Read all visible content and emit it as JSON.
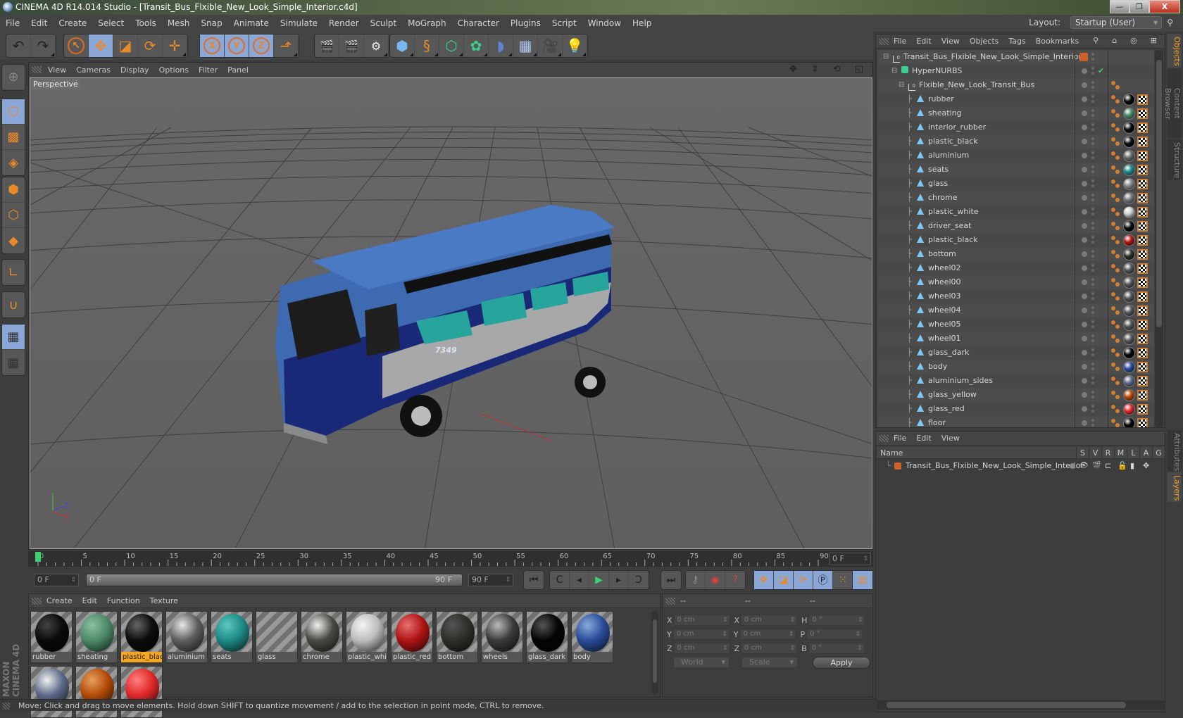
{
  "window": {
    "title": "CINEMA 4D R14.014 Studio - [Transit_Bus_Flxible_New_Look_Simple_Interior.c4d]",
    "minimize": "—",
    "restore": "❐",
    "close": "X"
  },
  "menubar": {
    "items": [
      "File",
      "Edit",
      "Create",
      "Select",
      "Tools",
      "Mesh",
      "Snap",
      "Animate",
      "Simulate",
      "Render",
      "Sculpt",
      "MoGraph",
      "Character",
      "Plugins",
      "Script",
      "Window",
      "Help"
    ],
    "layout_label": "Layout:",
    "layout_value": "Startup (User)"
  },
  "toolbar": {
    "groups": [
      [
        {
          "icon": "undo-icon",
          "glyph": "↶"
        },
        {
          "icon": "redo-icon",
          "glyph": "↷"
        }
      ],
      [
        {
          "icon": "live-selection-icon",
          "glyph": "↖"
        },
        {
          "icon": "move-icon",
          "glyph": "✥",
          "active": true
        },
        {
          "icon": "scale-icon",
          "glyph": "◪"
        },
        {
          "icon": "rotate-icon",
          "glyph": "⟳"
        },
        {
          "icon": "recent-tool-icon",
          "glyph": "✛"
        }
      ],
      [
        {
          "icon": "x-axis-lock-icon",
          "glyph": "X",
          "active": true
        },
        {
          "icon": "y-axis-lock-icon",
          "glyph": "Y",
          "active": true
        },
        {
          "icon": "z-axis-lock-icon",
          "glyph": "Z",
          "active": true
        },
        {
          "icon": "coordinate-system-icon",
          "glyph": "⬏"
        }
      ],
      [
        {
          "icon": "render-view-icon",
          "glyph": "🎬"
        },
        {
          "icon": "render-picture-viewer-icon",
          "glyph": "🎬"
        },
        {
          "icon": "render-settings-icon",
          "glyph": "⚙"
        }
      ],
      [
        {
          "icon": "cube-icon",
          "glyph": "⬢"
        },
        {
          "icon": "spline-icon",
          "glyph": "§"
        },
        {
          "icon": "nurbs-icon",
          "glyph": "⬡"
        },
        {
          "icon": "array-icon",
          "glyph": "✿"
        },
        {
          "icon": "deformer-icon",
          "glyph": "◗"
        },
        {
          "icon": "floor-icon",
          "glyph": "▦"
        },
        {
          "icon": "camera-icon",
          "glyph": "🎥"
        },
        {
          "icon": "light-icon",
          "glyph": "💡"
        }
      ]
    ]
  },
  "viewport": {
    "menu": [
      "View",
      "Cameras",
      "Display",
      "Options",
      "Filter",
      "Panel"
    ],
    "label": "Perspective",
    "bus_number": "7349",
    "axis_labels": {
      "x": "X",
      "y": "Y",
      "z": "Z"
    }
  },
  "timeline": {
    "ticks": [
      "0",
      "5",
      "10",
      "15",
      "20",
      "25",
      "30",
      "35",
      "40",
      "45",
      "50",
      "55",
      "60",
      "65",
      "70",
      "75",
      "80",
      "85",
      "90"
    ],
    "current_frame_field": "0 F",
    "start_field": "0 F",
    "range_start": "0 F",
    "range_end": "90 F",
    "end_field": "90 F"
  },
  "playback": {
    "goto_start": "⏮",
    "prev_key": "◀(",
    "prev_frame": "◂",
    "play": "▶",
    "next_frame": "▸",
    "next_key": ")▶",
    "goto_end": "⏭"
  },
  "material_manager": {
    "menu": [
      "Create",
      "Edit",
      "Function",
      "Texture"
    ],
    "materials": [
      {
        "name": "rubber",
        "color": "#0a0a0a",
        "hl": "#444"
      },
      {
        "name": "sheating",
        "color": "#4c8a68",
        "hl": "#8cc0a0"
      },
      {
        "name": "plastic_blac",
        "color": "#0c0c0c",
        "hl": "#666",
        "selected": true
      },
      {
        "name": "aluminium",
        "color": "#5e5e5e",
        "hl": "#e8e8e8"
      },
      {
        "name": "seats",
        "color": "#1e8a86",
        "hl": "#5cc8c0"
      },
      {
        "name": "glass",
        "color": "transparent",
        "hl": "transparent"
      },
      {
        "name": "chrome",
        "color": "#4a4a44",
        "hl": "#f0f0f0"
      },
      {
        "name": "plastic_whi",
        "color": "#bdbdbd",
        "hl": "#f4f4f4"
      },
      {
        "name": "plastic_red",
        "color": "#b01414",
        "hl": "#e87070"
      },
      {
        "name": "bottom",
        "color": "#2e2e2a",
        "hl": "#555"
      },
      {
        "name": "wheels",
        "color": "#3a3a3a",
        "hl": "#bbb"
      },
      {
        "name": "glass_dark",
        "color": "#050505",
        "hl": "#555"
      },
      {
        "name": "body",
        "color": "#2a4c9a",
        "hl": "#88aadd"
      },
      {
        "name": "",
        "color": "#5c6a8a",
        "hl": "#f0f0f0"
      },
      {
        "name": "",
        "color": "#b34a08",
        "hl": "#e8a060"
      },
      {
        "name": "",
        "color": "#e02828",
        "hl": "#ff8080"
      }
    ]
  },
  "coordinates": {
    "headers": [
      "--",
      "--",
      "--"
    ],
    "rows": [
      {
        "l1": "X",
        "v1": "0 cm",
        "l2": "X",
        "v2": "0 cm",
        "l3": "H",
        "v3": "0 °"
      },
      {
        "l1": "Y",
        "v1": "0 cm",
        "l2": "Y",
        "v2": "0 cm",
        "l3": "P",
        "v3": "0 °"
      },
      {
        "l1": "Z",
        "v1": "0 cm",
        "l2": "Z",
        "v2": "0 cm",
        "l3": "B",
        "v3": "0 °"
      }
    ],
    "space_select": "World",
    "mode_select": "Scale",
    "apply": "Apply"
  },
  "objects_panel": {
    "menu": [
      "File",
      "Edit",
      "View",
      "Objects",
      "Tags",
      "Bookmarks"
    ],
    "tree": [
      {
        "name": "Transit_Bus_Flxible_New_Look_Simple_Interior",
        "type": "null",
        "level": 0
      },
      {
        "name": "HyperNURBS",
        "type": "nurbs",
        "level": 1
      },
      {
        "name": "Flxible_New_Look_Transit_Bus",
        "type": "null",
        "level": 2
      },
      {
        "name": "rubber",
        "type": "poly",
        "level": 3,
        "mat": "#0a0a0a"
      },
      {
        "name": "sheating",
        "type": "poly",
        "level": 3,
        "mat": "#4c8a68"
      },
      {
        "name": "interior_rubber",
        "type": "poly",
        "level": 3,
        "mat": "#0a0a0a"
      },
      {
        "name": "plastic_black",
        "type": "poly",
        "level": 3,
        "mat": "#0c0c0c"
      },
      {
        "name": "aluminium",
        "type": "poly",
        "level": 3,
        "mat": "#6a6a6a"
      },
      {
        "name": "seats",
        "type": "poly",
        "level": 3,
        "mat": "#1e8a86"
      },
      {
        "name": "glass",
        "type": "poly",
        "level": 3,
        "mat": "#888888"
      },
      {
        "name": "chrome",
        "type": "poly",
        "level": 3,
        "mat": "#777777"
      },
      {
        "name": "plastic_white",
        "type": "poly",
        "level": 3,
        "mat": "#d0d0d0"
      },
      {
        "name": "driver_seat",
        "type": "poly",
        "level": 3,
        "mat": "#0a0a0a"
      },
      {
        "name": "plastic_black",
        "type": "poly",
        "level": 3,
        "mat": "#b01414"
      },
      {
        "name": "bottom",
        "type": "poly",
        "level": 3,
        "mat": "#2e2e2a"
      },
      {
        "name": "wheel02",
        "type": "poly",
        "level": 3,
        "mat": "#555555"
      },
      {
        "name": "wheel00",
        "type": "poly",
        "level": 3,
        "mat": "#555555"
      },
      {
        "name": "wheel03",
        "type": "poly",
        "level": 3,
        "mat": "#555555"
      },
      {
        "name": "wheel04",
        "type": "poly",
        "level": 3,
        "mat": "#555555"
      },
      {
        "name": "wheel05",
        "type": "poly",
        "level": 3,
        "mat": "#555555"
      },
      {
        "name": "wheel01",
        "type": "poly",
        "level": 3,
        "mat": "#555555"
      },
      {
        "name": "glass_dark",
        "type": "poly",
        "level": 3,
        "mat": "#050505"
      },
      {
        "name": "body",
        "type": "poly",
        "level": 3,
        "mat": "#2a4c9a"
      },
      {
        "name": "aluminium_sides",
        "type": "poly",
        "level": 3,
        "mat": "#5c6a8a"
      },
      {
        "name": "glass_yellow",
        "type": "poly",
        "level": 3,
        "mat": "#b34a08"
      },
      {
        "name": "glass_red",
        "type": "poly",
        "level": 3,
        "mat": "#e02828"
      },
      {
        "name": "floor",
        "type": "poly",
        "level": 3,
        "mat": "#050505"
      }
    ]
  },
  "side_tabs": {
    "top": [
      "Objects",
      "Content Browser",
      "Structure"
    ],
    "bottom": [
      "Attributes",
      "Layers"
    ]
  },
  "layers_panel": {
    "menu": [
      "File",
      "Edit",
      "View"
    ],
    "columns": [
      "Name",
      "S",
      "V",
      "R",
      "M",
      "L",
      "A",
      "G"
    ],
    "rows": [
      {
        "name": "Transit_Bus_Flxible_New_Look_Simple_Interior",
        "color": "#d0602a"
      }
    ]
  },
  "status": "Move: Click and drag to move elements. Hold down SHIFT to quantize movement / add to the selection in point mode, CTRL to remove.",
  "branding": "MAXON CINEMA 4D",
  "colors": {
    "accent": "#8aa7d8",
    "orange": "#e8892a",
    "selection": "#f5a623"
  }
}
